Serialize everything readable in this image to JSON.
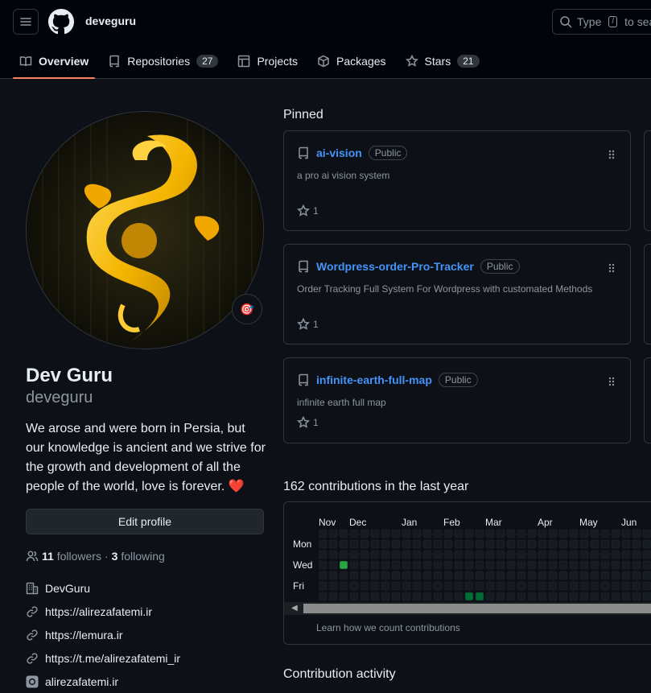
{
  "header": {
    "username": "deveguru",
    "search_prefix": "Type",
    "search_key": "/",
    "search_suffix": "to sea"
  },
  "tabs": [
    {
      "label": "Overview",
      "icon": "book-icon",
      "active": true
    },
    {
      "label": "Repositories",
      "icon": "repo-icon",
      "count": "27"
    },
    {
      "label": "Projects",
      "icon": "table-icon"
    },
    {
      "label": "Packages",
      "icon": "package-icon"
    },
    {
      "label": "Stars",
      "icon": "star-icon",
      "count": "21"
    }
  ],
  "profile": {
    "name": "Dev Guru",
    "login": "deveguru",
    "bio": "We arose and were born in Persia, but our knowledge is ancient and we strive for the growth and development of all the people of the world, love is forever.",
    "bio_emoji": "❤️",
    "status_emoji": "🎯",
    "edit_label": "Edit profile",
    "followers_count": "11",
    "followers_label": "followers",
    "following_count": "3",
    "following_label": "following",
    "company": "DevGuru",
    "links": [
      "https://alirezafatemi.ir",
      "https://lemura.ir",
      "https://t.me/alirezafatemi_ir"
    ],
    "instagram": "alirezafatemi.ir"
  },
  "pinned": {
    "title": "Pinned",
    "repos": [
      {
        "name": "ai-vision",
        "visibility": "Public",
        "description": "a pro ai vision system",
        "stars": "1"
      },
      {
        "name": "Wordpress-order-Pro-Tracker",
        "visibility": "Public",
        "description": "Order Tracking Full System For Wordpress with customated Methods",
        "stars": "1"
      },
      {
        "name": "infinite-earth-full-map",
        "visibility": "Public",
        "description": "infinite earth full map",
        "stars": "1"
      }
    ]
  },
  "contributions": {
    "title": "162 contributions in the last year",
    "months": [
      "Nov",
      "Dec",
      "Jan",
      "Feb",
      "Mar",
      "Apr",
      "May",
      "Jun"
    ],
    "days": [
      "Mon",
      "Wed",
      "Fri"
    ],
    "learn_link": "Learn how we count contributions"
  },
  "activity": {
    "title": "Contribution activity"
  },
  "colors": {
    "background": "#0d1117",
    "link": "#4493f8",
    "accent_underline": "#f78166",
    "contrib_empty": "#161b22",
    "contrib_level1": "#0e4429",
    "contrib_level2": "#006d32",
    "contrib_level3": "#26a641"
  }
}
